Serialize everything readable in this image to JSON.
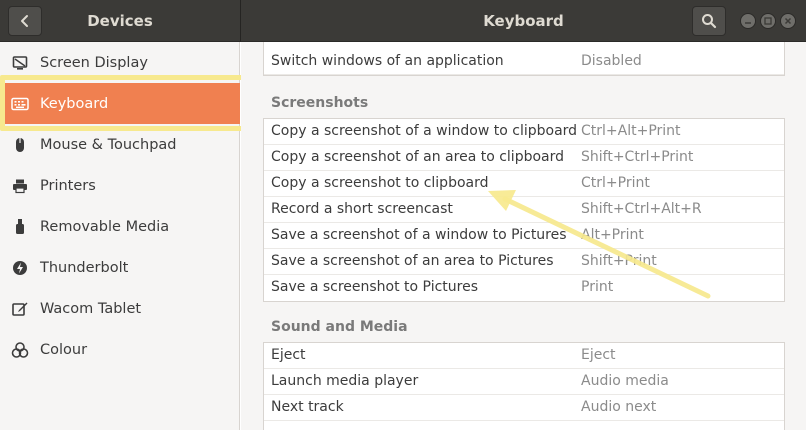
{
  "header": {
    "left_title": "Devices",
    "right_title": "Keyboard"
  },
  "sidebar": {
    "items": [
      {
        "label": "Screen Display",
        "icon": "display-icon"
      },
      {
        "label": "Keyboard",
        "icon": "keyboard-icon",
        "active": true
      },
      {
        "label": "Mouse & Touchpad",
        "icon": "mouse-icon"
      },
      {
        "label": "Printers",
        "icon": "printer-icon"
      },
      {
        "label": "Removable Media",
        "icon": "usb-icon"
      },
      {
        "label": "Thunderbolt",
        "icon": "thunderbolt-icon"
      },
      {
        "label": "Wacom Tablet",
        "icon": "tablet-icon"
      },
      {
        "label": "Colour",
        "icon": "colour-icon"
      }
    ]
  },
  "windows_list": {
    "rows": [
      {
        "name": "Switch windows of an application",
        "key": "Disabled"
      }
    ]
  },
  "screenshots": {
    "title": "Screenshots",
    "rows": [
      {
        "name": "Copy a screenshot of a window to clipboard",
        "key": "Ctrl+Alt+Print"
      },
      {
        "name": "Copy a screenshot of an area to clipboard",
        "key": "Shift+Ctrl+Print"
      },
      {
        "name": "Copy a screenshot to clipboard",
        "key": "Ctrl+Print"
      },
      {
        "name": "Record a short screencast",
        "key": "Shift+Ctrl+Alt+R"
      },
      {
        "name": "Save a screenshot of a window to Pictures",
        "key": "Alt+Print"
      },
      {
        "name": "Save a screenshot of an area to Pictures",
        "key": "Shift+Print"
      },
      {
        "name": "Save a screenshot to Pictures",
        "key": "Print"
      }
    ]
  },
  "sound_media": {
    "title": "Sound and Media",
    "rows": [
      {
        "name": "Eject",
        "key": "Eject"
      },
      {
        "name": "Launch media player",
        "key": "Audio media"
      },
      {
        "name": "Next track",
        "key": "Audio next"
      }
    ]
  },
  "colors": {
    "accent": "#f08050",
    "annotation": "#f7e98e",
    "header_bg": "#3b3a37"
  }
}
